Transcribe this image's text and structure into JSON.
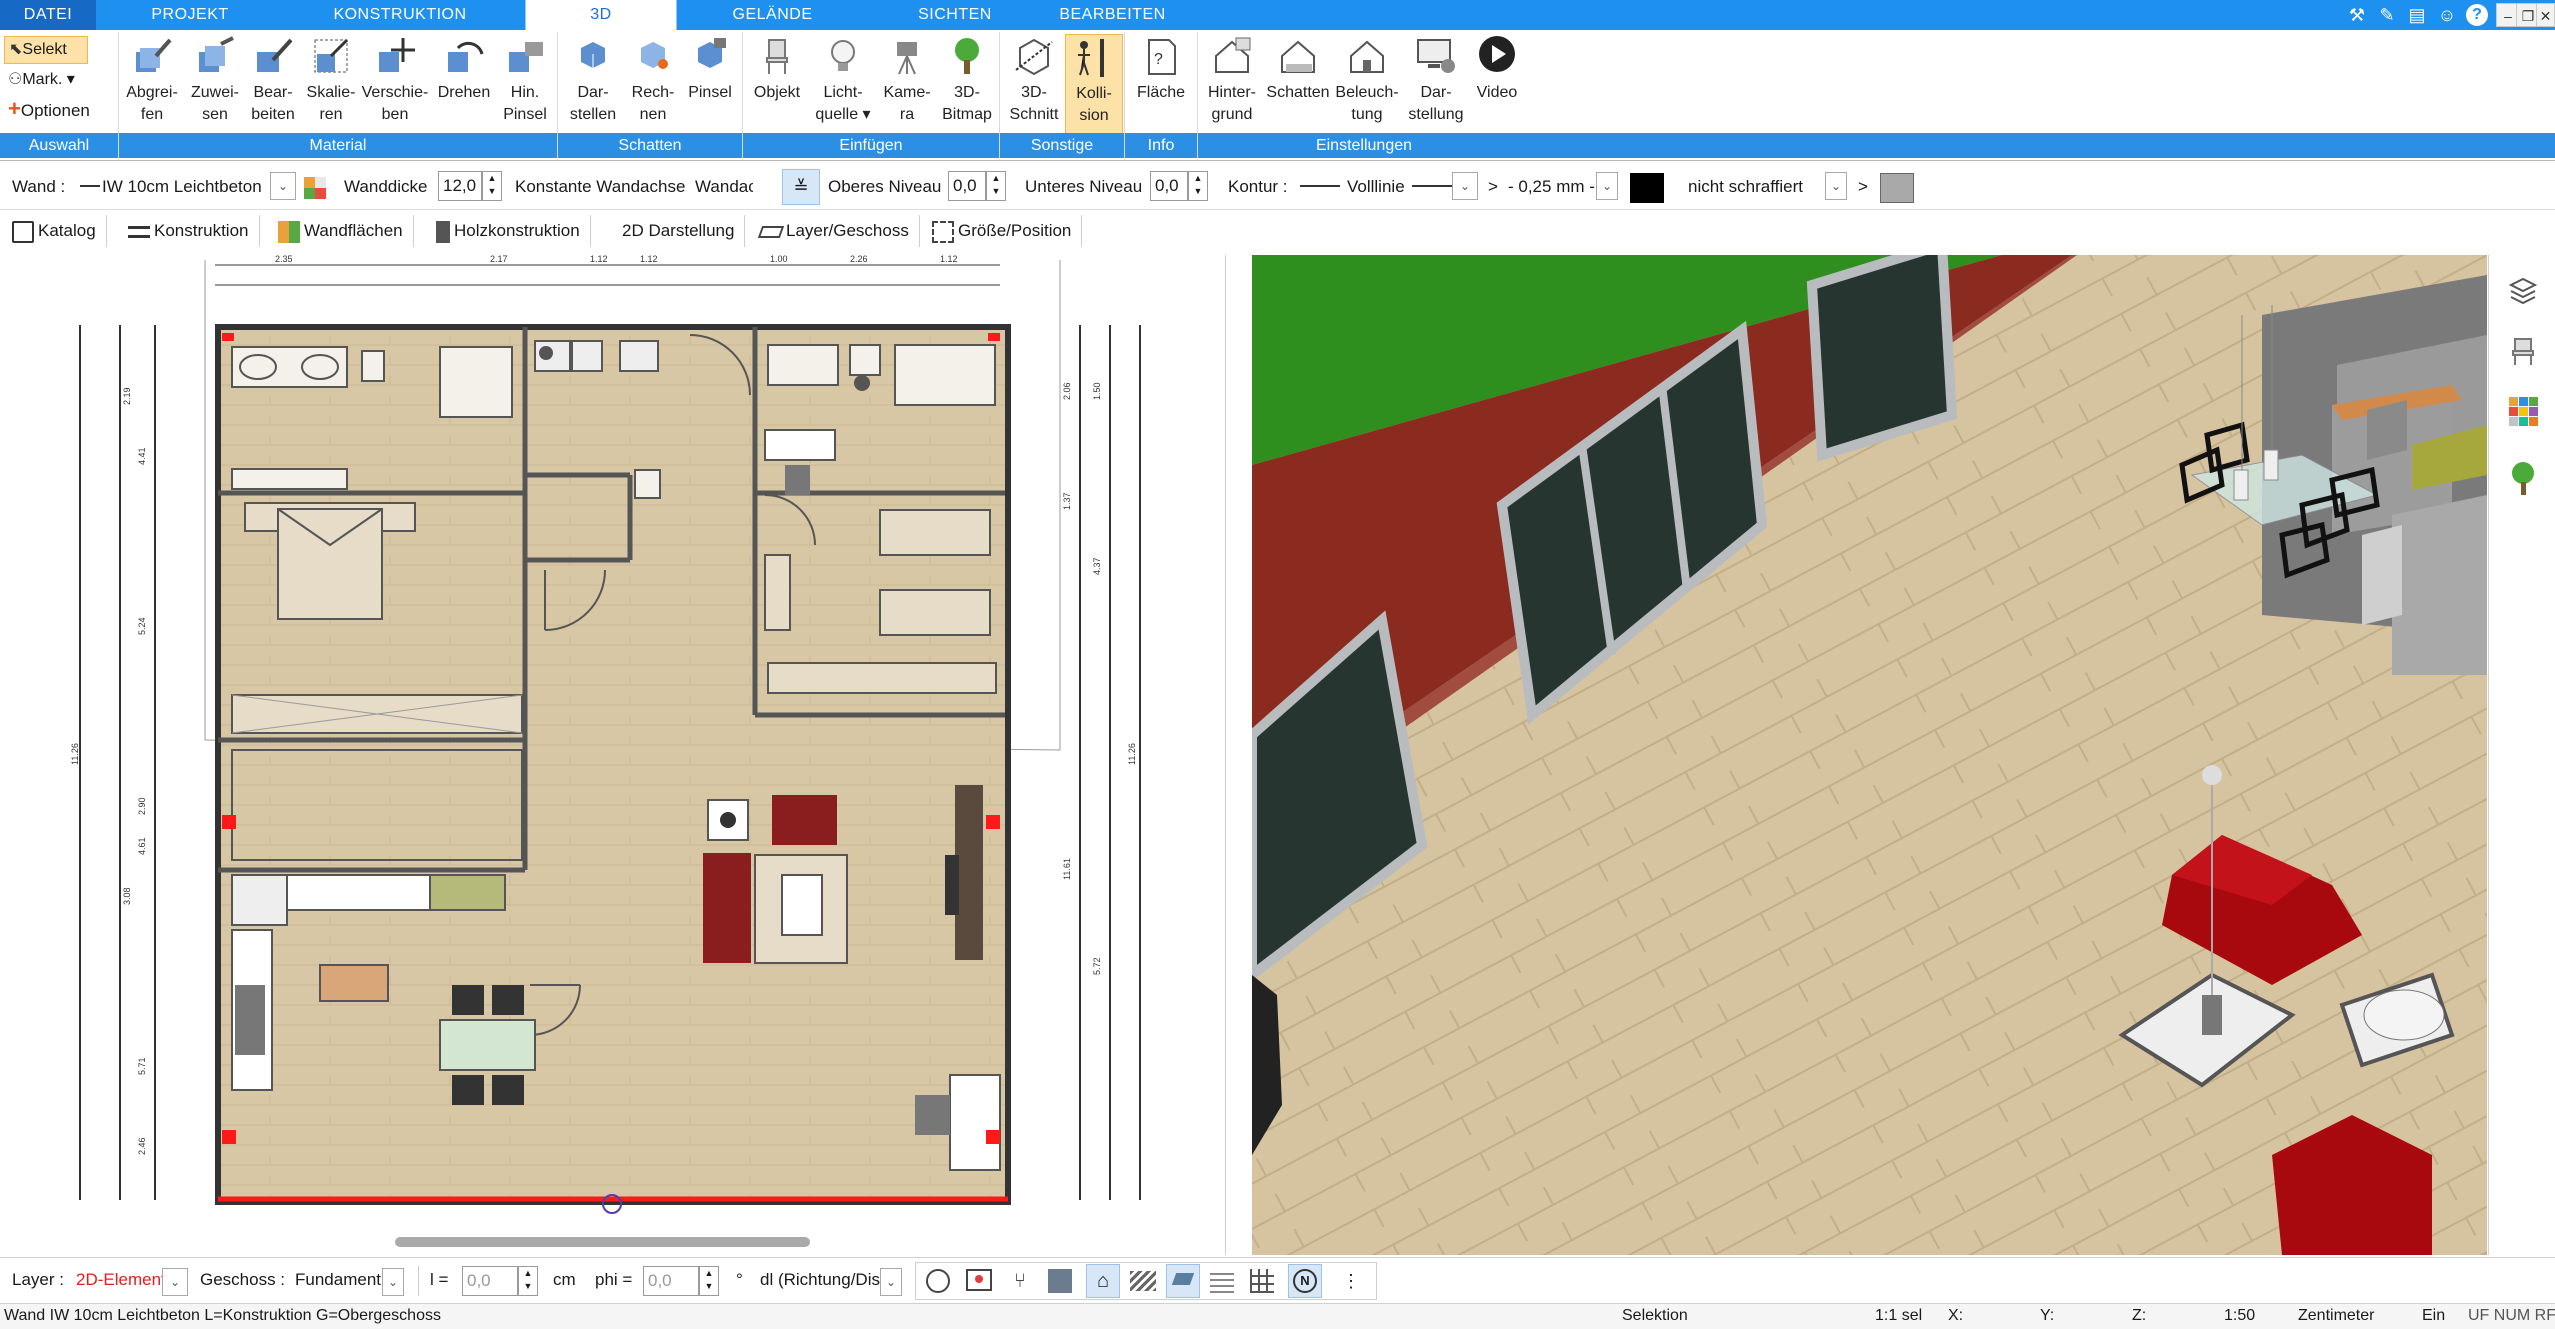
{
  "tabs": [
    {
      "label": "DATEI"
    },
    {
      "label": "PROJEKT"
    },
    {
      "label": "KONSTRUKTION"
    },
    {
      "label": "3D"
    },
    {
      "label": "GELÄNDE"
    },
    {
      "label": "SICHTEN"
    },
    {
      "label": "BEARBEITEN"
    }
  ],
  "window_buttons": [
    "minimize",
    "restore",
    "close"
  ],
  "ribbon": {
    "auswahl": {
      "selekt": "Selekt",
      "mark": "Mark.",
      "optionen": "Optionen",
      "group": "Auswahl"
    },
    "material": {
      "group": "Material",
      "buttons": [
        {
          "l1": "Abgrei-",
          "l2": "fen"
        },
        {
          "l1": "Zuwei-",
          "l2": "sen"
        },
        {
          "l1": "Bear-",
          "l2": "beiten"
        },
        {
          "l1": "Skalie-",
          "l2": "ren"
        },
        {
          "l1": "Verschie-",
          "l2": "ben"
        },
        {
          "l1": "Drehen",
          "l2": ""
        },
        {
          "l1": "Hin.",
          "l2": "Pinsel"
        }
      ]
    },
    "schatten": {
      "group": "Schatten",
      "buttons": [
        {
          "l1": "Dar-",
          "l2": "stellen"
        },
        {
          "l1": "Rech-",
          "l2": "nen"
        },
        {
          "l1": "Pinsel",
          "l2": ""
        }
      ]
    },
    "einfuegen": {
      "group": "Einfügen",
      "buttons": [
        {
          "l1": "Objekt",
          "l2": ""
        },
        {
          "l1": "Licht-",
          "l2": "quelle ▾"
        },
        {
          "l1": "Kame-",
          "l2": "ra"
        },
        {
          "l1": "3D-",
          "l2": "Bitmap"
        }
      ]
    },
    "sonstige": {
      "group": "Sonstige",
      "buttons": [
        {
          "l1": "3D-",
          "l2": "Schnitt"
        },
        {
          "l1": "Kolli-",
          "l2": "sion"
        }
      ]
    },
    "info": {
      "group": "Info",
      "buttons": [
        {
          "l1": "Fläche",
          "l2": ""
        }
      ]
    },
    "einstellungen": {
      "group": "Einstellungen",
      "buttons": [
        {
          "l1": "Hinter-",
          "l2": "grund"
        },
        {
          "l1": "Schatten",
          "l2": ""
        },
        {
          "l1": "Beleuch-",
          "l2": "tung"
        },
        {
          "l1": "Dar-",
          "l2": "stellung"
        },
        {
          "l1": "Video",
          "l2": ""
        }
      ]
    }
  },
  "propbar": {
    "wand_label": "Wand :",
    "wand_value": "IW 10cm Leichtbeton",
    "wanddicke_label": "Wanddicke",
    "wanddicke_value": "12,0",
    "konst_label": "Konstante Wandachse",
    "wandachse_value": "Wandachse",
    "oberes_label": "Oberes Niveau",
    "oberes_value": "0,0",
    "unteres_label": "Unteres Niveau",
    "unteres_value": "0,0",
    "kontur_label": "Kontur :",
    "linie_value": "Volllinie",
    "gt1": ">",
    "mm_value": "- 0,25 mm -",
    "schraffur_value": "nicht schraffiert",
    "gt2": ">"
  },
  "toolbar2": [
    {
      "label": "Katalog"
    },
    {
      "label": "Konstruktion"
    },
    {
      "label": "Wandflächen"
    },
    {
      "label": "Holzkonstruktion"
    },
    {
      "label": "2D Darstellung"
    },
    {
      "label": "Layer/Geschoss"
    },
    {
      "label": "Größe/Position"
    }
  ],
  "plan": {
    "dims_top": [
      "2.35",
      "2.17",
      "1.12",
      "1.12",
      "1.00",
      "2.26",
      "1.12"
    ],
    "dims_left": [
      "2.19",
      "4.41",
      "5.24",
      "2.90",
      "4.61",
      "3.08",
      "5.71",
      "2.46"
    ],
    "dims_right": [
      "2.06",
      "1.50",
      "1.37",
      "4.37",
      "11.61",
      "5.72"
    ],
    "total": "11.26"
  },
  "bottom": {
    "layer_label": "Layer :",
    "layer_value": "2D-Elemente",
    "geschoss_label": "Geschoss :",
    "geschoss_value": "Fundament",
    "l_label": "l =",
    "l_value": "0,0",
    "cm": "cm",
    "phi_label": "phi =",
    "phi_value": "0,0",
    "deg": "°",
    "dl_value": "dl (Richtung/Dist.)"
  },
  "status": {
    "info": "Wand IW 10cm Leichtbeton L=Konstruktion G=Obergeschoss",
    "mode": "Selektion",
    "sel": "1:1 sel",
    "x": "X:",
    "y": "Y:",
    "z": "Z:",
    "scale": "1:50",
    "unit": "Zentimeter",
    "ein": "Ein",
    "flags": "UF NUM RF"
  },
  "colors": {
    "ribbon_blue": "#1e90ef",
    "group_blue": "#2b8fe6",
    "wall_red": "#8b2a1e",
    "sofa_red": "#a8090f",
    "floor": "#d6c3a0",
    "grass": "#2f8f1e"
  }
}
